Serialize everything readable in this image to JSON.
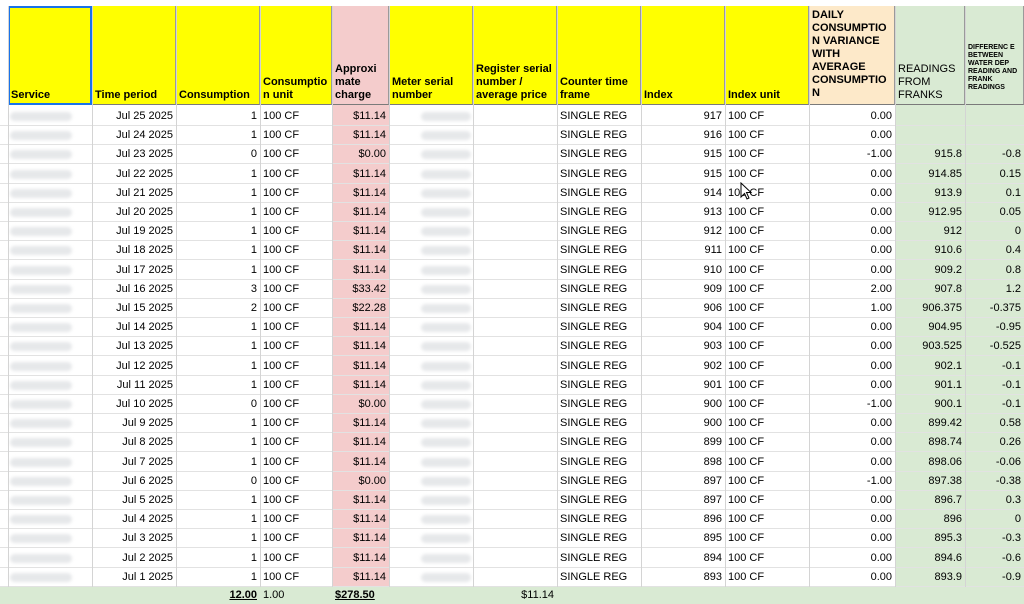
{
  "headers": {
    "service": "Service",
    "time_period": "Time period",
    "consumption": "Consumption",
    "consumption_unit": "Consumptio n unit",
    "approx_charge": "Approxi mate charge",
    "meter_serial": "Meter serial number",
    "register_serial": "Register serial number / average price",
    "counter_time_frame": "Counter time frame",
    "index": "Index",
    "index_unit": "Index unit",
    "daily_variance": "DAILY CONSUMPTIO N VARIANCE WITH AVERAGE CONSUMPTIO N",
    "readings_franks": "READINGS FROM FRANKS",
    "difference": "DIFFERENC E BETWEEN WATER DEP READING AND FRANK READINGS"
  },
  "colors": {
    "header_yellow": "#ffff00",
    "charge_pink": "#f4cccc",
    "variance_peach": "#fde9c9",
    "franks_green": "#d9ead3",
    "selection_blue": "#1a73e8"
  },
  "rows": [
    {
      "time_period": "Jul 25 2025",
      "consumption": "1",
      "unit": "100 CF",
      "charge": "$11.14",
      "timeframe": "SINGLE REG",
      "index": "917",
      "index_unit": "100 CF",
      "variance": "0.00",
      "franks": "",
      "diff": ""
    },
    {
      "time_period": "Jul 24 2025",
      "consumption": "1",
      "unit": "100 CF",
      "charge": "$11.14",
      "timeframe": "SINGLE REG",
      "index": "916",
      "index_unit": "100 CF",
      "variance": "0.00",
      "franks": "",
      "diff": ""
    },
    {
      "time_period": "Jul 23 2025",
      "consumption": "0",
      "unit": "100 CF",
      "charge": "$0.00",
      "timeframe": "SINGLE REG",
      "index": "915",
      "index_unit": "100 CF",
      "variance": "-1.00",
      "franks": "915.8",
      "diff": "-0.8"
    },
    {
      "time_period": "Jul 22 2025",
      "consumption": "1",
      "unit": "100 CF",
      "charge": "$11.14",
      "timeframe": "SINGLE REG",
      "index": "915",
      "index_unit": "100 CF",
      "variance": "0.00",
      "franks": "914.85",
      "diff": "0.15"
    },
    {
      "time_period": "Jul 21 2025",
      "consumption": "1",
      "unit": "100 CF",
      "charge": "$11.14",
      "timeframe": "SINGLE REG",
      "index": "914",
      "index_unit": "100 CF",
      "variance": "0.00",
      "franks": "913.9",
      "diff": "0.1"
    },
    {
      "time_period": "Jul 20 2025",
      "consumption": "1",
      "unit": "100 CF",
      "charge": "$11.14",
      "timeframe": "SINGLE REG",
      "index": "913",
      "index_unit": "100 CF",
      "variance": "0.00",
      "franks": "912.95",
      "diff": "0.05"
    },
    {
      "time_period": "Jul 19 2025",
      "consumption": "1",
      "unit": "100 CF",
      "charge": "$11.14",
      "timeframe": "SINGLE REG",
      "index": "912",
      "index_unit": "100 CF",
      "variance": "0.00",
      "franks": "912",
      "diff": "0"
    },
    {
      "time_period": "Jul 18 2025",
      "consumption": "1",
      "unit": "100 CF",
      "charge": "$11.14",
      "timeframe": "SINGLE REG",
      "index": "911",
      "index_unit": "100 CF",
      "variance": "0.00",
      "franks": "910.6",
      "diff": "0.4"
    },
    {
      "time_period": "Jul 17 2025",
      "consumption": "1",
      "unit": "100 CF",
      "charge": "$11.14",
      "timeframe": "SINGLE REG",
      "index": "910",
      "index_unit": "100 CF",
      "variance": "0.00",
      "franks": "909.2",
      "diff": "0.8"
    },
    {
      "time_period": "Jul 16 2025",
      "consumption": "3",
      "unit": "100 CF",
      "charge": "$33.42",
      "timeframe": "SINGLE REG",
      "index": "909",
      "index_unit": "100 CF",
      "variance": "2.00",
      "franks": "907.8",
      "diff": "1.2"
    },
    {
      "time_period": "Jul 15 2025",
      "consumption": "2",
      "unit": "100 CF",
      "charge": "$22.28",
      "timeframe": "SINGLE REG",
      "index": "906",
      "index_unit": "100 CF",
      "variance": "1.00",
      "franks": "906.375",
      "diff": "-0.375"
    },
    {
      "time_period": "Jul 14 2025",
      "consumption": "1",
      "unit": "100 CF",
      "charge": "$11.14",
      "timeframe": "SINGLE REG",
      "index": "904",
      "index_unit": "100 CF",
      "variance": "0.00",
      "franks": "904.95",
      "diff": "-0.95"
    },
    {
      "time_period": "Jul 13 2025",
      "consumption": "1",
      "unit": "100 CF",
      "charge": "$11.14",
      "timeframe": "SINGLE REG",
      "index": "903",
      "index_unit": "100 CF",
      "variance": "0.00",
      "franks": "903.525",
      "diff": "-0.525"
    },
    {
      "time_period": "Jul 12 2025",
      "consumption": "1",
      "unit": "100 CF",
      "charge": "$11.14",
      "timeframe": "SINGLE REG",
      "index": "902",
      "index_unit": "100 CF",
      "variance": "0.00",
      "franks": "902.1",
      "diff": "-0.1"
    },
    {
      "time_period": "Jul 11 2025",
      "consumption": "1",
      "unit": "100 CF",
      "charge": "$11.14",
      "timeframe": "SINGLE REG",
      "index": "901",
      "index_unit": "100 CF",
      "variance": "0.00",
      "franks": "901.1",
      "diff": "-0.1"
    },
    {
      "time_period": "Jul 10 2025",
      "consumption": "0",
      "unit": "100 CF",
      "charge": "$0.00",
      "timeframe": "SINGLE REG",
      "index": "900",
      "index_unit": "100 CF",
      "variance": "-1.00",
      "franks": "900.1",
      "diff": "-0.1"
    },
    {
      "time_period": "Jul 9 2025",
      "consumption": "1",
      "unit": "100 CF",
      "charge": "$11.14",
      "timeframe": "SINGLE REG",
      "index": "900",
      "index_unit": "100 CF",
      "variance": "0.00",
      "franks": "899.42",
      "diff": "0.58"
    },
    {
      "time_period": "Jul 8 2025",
      "consumption": "1",
      "unit": "100 CF",
      "charge": "$11.14",
      "timeframe": "SINGLE REG",
      "index": "899",
      "index_unit": "100 CF",
      "variance": "0.00",
      "franks": "898.74",
      "diff": "0.26"
    },
    {
      "time_period": "Jul 7 2025",
      "consumption": "1",
      "unit": "100 CF",
      "charge": "$11.14",
      "timeframe": "SINGLE REG",
      "index": "898",
      "index_unit": "100 CF",
      "variance": "0.00",
      "franks": "898.06",
      "diff": "-0.06"
    },
    {
      "time_period": "Jul 6 2025",
      "consumption": "0",
      "unit": "100 CF",
      "charge": "$0.00",
      "timeframe": "SINGLE REG",
      "index": "897",
      "index_unit": "100 CF",
      "variance": "-1.00",
      "franks": "897.38",
      "diff": "-0.38"
    },
    {
      "time_period": "Jul 5 2025",
      "consumption": "1",
      "unit": "100 CF",
      "charge": "$11.14",
      "timeframe": "SINGLE REG",
      "index": "897",
      "index_unit": "100 CF",
      "variance": "0.00",
      "franks": "896.7",
      "diff": "0.3"
    },
    {
      "time_period": "Jul 4 2025",
      "consumption": "1",
      "unit": "100 CF",
      "charge": "$11.14",
      "timeframe": "SINGLE REG",
      "index": "896",
      "index_unit": "100 CF",
      "variance": "0.00",
      "franks": "896",
      "diff": "0"
    },
    {
      "time_period": "Jul 3 2025",
      "consumption": "1",
      "unit": "100 CF",
      "charge": "$11.14",
      "timeframe": "SINGLE REG",
      "index": "895",
      "index_unit": "100 CF",
      "variance": "0.00",
      "franks": "895.3",
      "diff": "-0.3"
    },
    {
      "time_period": "Jul 2 2025",
      "consumption": "1",
      "unit": "100 CF",
      "charge": "$11.14",
      "timeframe": "SINGLE REG",
      "index": "894",
      "index_unit": "100 CF",
      "variance": "0.00",
      "franks": "894.6",
      "diff": "-0.6"
    },
    {
      "time_period": "Jul 1 2025",
      "consumption": "1",
      "unit": "100 CF",
      "charge": "$11.14",
      "timeframe": "SINGLE REG",
      "index": "893",
      "index_unit": "100 CF",
      "variance": "0.00",
      "franks": "893.9",
      "diff": "-0.9"
    }
  ],
  "totals": {
    "consumption": "12.00",
    "unit": "1.00",
    "charge": "$278.50",
    "average_price": "$11.14"
  }
}
